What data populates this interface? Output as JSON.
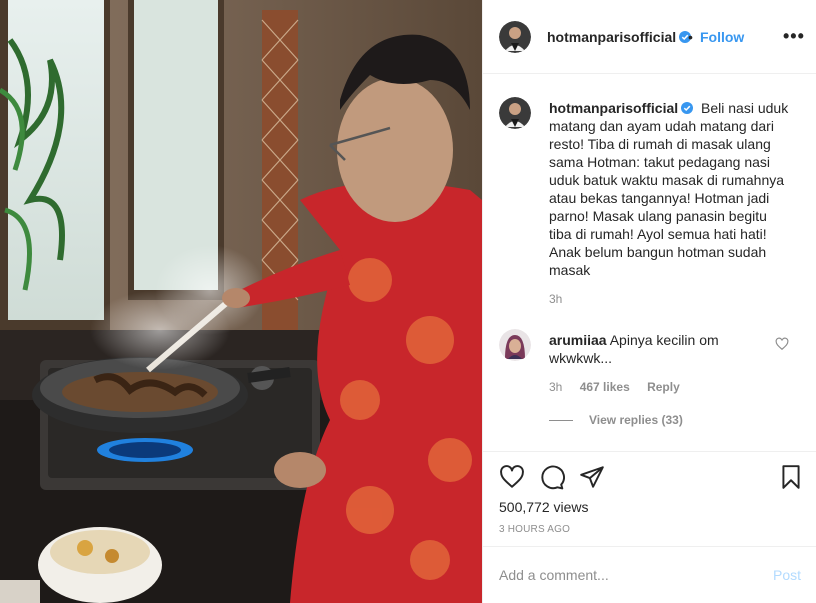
{
  "post": {
    "username": "hotmanparisofficial",
    "dot": "•",
    "follow_label": "Follow",
    "more_label": "•••",
    "caption": "Beli nasi uduk matang dan ayam udah matang dari resto! Tiba di rumah di masak ulang sama Hotman: takut pedagang nasi uduk batuk waktu masak di rumahnya atau bekas tangannya! Hotman jadi parno! Masak ulang panasin begitu tiba di rumah! Ayol semua hati hati! Anak belum bangun hotman sudah masak",
    "caption_time": "3h",
    "comment": {
      "username": "arumiiaa",
      "text": "Apinya kecilin om wkwkwk...",
      "time": "3h",
      "likes": "467 likes",
      "reply_label": "Reply",
      "view_replies": "View replies (33)"
    },
    "views": "500,772 views",
    "posted": "3 HOURS AGO",
    "add_comment_placeholder": "Add a comment...",
    "post_label": "Post"
  },
  "icons": {
    "verified": "verified-badge-icon",
    "like": "heart-icon",
    "comment": "comment-icon",
    "share": "share-icon",
    "save": "bookmark-icon",
    "comment_like": "small-heart-icon"
  },
  "colors": {
    "accent": "#3897f0",
    "post_disabled": "#b3dbff",
    "muted": "#8e8e8e",
    "text": "#262626",
    "border": "#efefef"
  }
}
